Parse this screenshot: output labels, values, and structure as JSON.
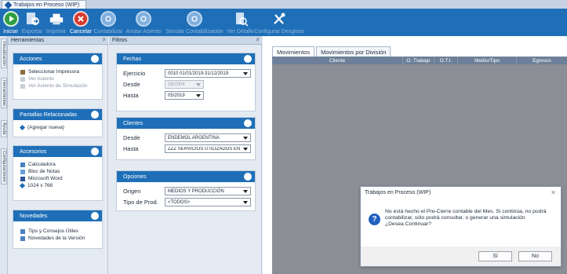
{
  "window": {
    "tab_title": "Trabajos en Proceso (WIP)"
  },
  "toolbar": {
    "buttons": [
      {
        "label": "Iniciar",
        "icon": "play-icon",
        "enabled": true
      },
      {
        "label": "Exportar",
        "icon": "export-icon",
        "enabled": false
      },
      {
        "label": "Imprimir",
        "icon": "printer-icon",
        "enabled": false
      },
      {
        "label": "Cancelar",
        "icon": "cancel-icon",
        "enabled": true
      },
      {
        "label": "Contabilizar",
        "icon": "post-icon",
        "enabled": false
      },
      {
        "label": "Anular Asiento",
        "icon": "void-entry-icon",
        "enabled": false
      },
      {
        "label": "Simular Contabilización",
        "icon": "simulate-icon",
        "enabled": false
      },
      {
        "label": "Ver Detalle",
        "icon": "detail-icon",
        "enabled": false
      },
      {
        "label": "Configurar Desglose",
        "icon": "tools-icon",
        "enabled": false
      }
    ]
  },
  "side_tabs": [
    "Visualización",
    "Herramientas",
    "Ayuda",
    "Configuraciones"
  ],
  "herramientas": {
    "title": "Herramientas",
    "pin": "ᵖ",
    "acciones": {
      "title": "Acciones",
      "items": [
        "Seleccionar Impresora",
        "Ver Asiento",
        "Ver Asiento de Simulación"
      ]
    },
    "pantallas": {
      "title": "Pantallas Relacionadas",
      "items": [
        "(Agregar nueva)"
      ]
    },
    "accesorios": {
      "title": "Accesorios",
      "items": [
        "Calculadora",
        "Bloc de Notas",
        "Microsoft Word",
        "1024 x 768"
      ]
    },
    "novedades": {
      "title": "Novedades",
      "items": [
        "Tips y Consejos Útiles",
        "Novedades de la Versión"
      ]
    }
  },
  "filtros": {
    "title": "Filtros",
    "pin": "ᵖ",
    "fechas": {
      "title": "Fechas",
      "ejercicio_label": "Ejercicio",
      "ejercicio_value": "0010 01/01/2019-31/12/2019",
      "desde_label": "Desde",
      "desde_value": "08/2004",
      "hasta_label": "Hasta",
      "hasta_value": "05/2019"
    },
    "clientes": {
      "title": "Clientes",
      "desde_label": "Desde",
      "desde_value": "ENDEMOL ARGENTINA",
      "hasta_label": "Hasta",
      "hasta_value": "ZZZ SERVICIOS UTILIZADOS EN E"
    },
    "opciones": {
      "title": "Opciones",
      "origen_label": "Origen",
      "origen_value": "MEDIOS Y PRODUCCIÓN",
      "tipo_label": "Tipo de Prod.",
      "tipo_value": "<TODOS>"
    }
  },
  "main": {
    "tabs": [
      "Movimientos",
      "Movimientos por División"
    ],
    "columns": [
      "Cliente",
      "O. Trabajo",
      "O.T.I.",
      "Medio/Tipo",
      "Egresos"
    ]
  },
  "dialog": {
    "title": "Trabajos en Proceso (WIP)",
    "close": "✕",
    "message": "No está hecho el Pre-Cierre contable del Mes. Si continúa, no podrá contabilizar, sólo podrá consultar. o generar una simulación\n¿Desea Continuar?",
    "yes_label": "Sí",
    "no_label": "No"
  }
}
